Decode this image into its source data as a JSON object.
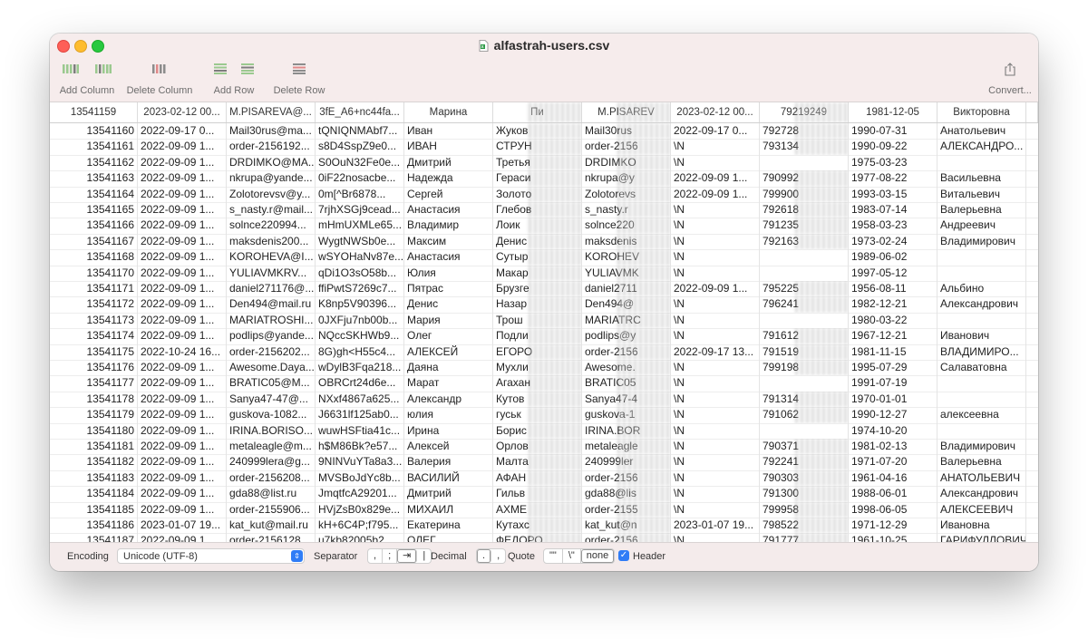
{
  "window": {
    "title": "alfastrah-users.csv"
  },
  "toolbar": {
    "add_column": "Add Column",
    "delete_column": "Delete Column",
    "add_row": "Add Row",
    "delete_row": "Delete Row",
    "convert": "Convert..."
  },
  "header_row": [
    "13541159",
    "2023-02-12 00...",
    "M.PISAREVA@...",
    "3fE_A6+nc44fa...",
    "Марина",
    "Пи",
    "M.PISAREV",
    "2023-02-12 00...",
    "79219249",
    "1981-12-05",
    "Викторовна"
  ],
  "rows": [
    [
      "13541160",
      "2022-09-17 0...",
      "Mail30rus@ma...",
      "tQNIQNMAbf7...",
      "Иван",
      "Жуков",
      "Mail30rus",
      "2022-09-17 0...",
      "792728",
      "1990-07-31",
      "Анатольевич"
    ],
    [
      "13541161",
      "2022-09-09 1...",
      "order-2156192...",
      "s8D4SspZ9e0...",
      "ИВАН",
      "СТРУН",
      "order-2156",
      "\\N",
      "793134",
      "1990-09-22",
      "АЛЕКСАНДРО..."
    ],
    [
      "13541162",
      "2022-09-09 1...",
      "DRDIMKO@MA...",
      "S0OuN32Fe0e...",
      "Дмитрий",
      "Третья",
      "DRDIMKO",
      "\\N",
      "",
      "1975-03-23",
      ""
    ],
    [
      "13541163",
      "2022-09-09 1...",
      "nkrupa@yande...",
      "0iF22nosacbe...",
      "Надежда",
      "Гераси",
      "nkrupa@y",
      "2022-09-09 1...",
      "790992",
      "1977-08-22",
      "Васильевна"
    ],
    [
      "13541164",
      "2022-09-09 1...",
      "Zolotorevsv@y...",
      "0m[^Br6878...",
      "Сергей",
      "Золото",
      "Zolotorevs",
      "2022-09-09 1...",
      "799900",
      "1993-03-15",
      "Витальевич"
    ],
    [
      "13541165",
      "2022-09-09 1...",
      "s_nasty.r@mail...",
      "7rjhXSGj9cead...",
      "Анастасия",
      "Глебов",
      "s_nasty.r",
      "\\N",
      "792618",
      "1983-07-14",
      "Валерьевна"
    ],
    [
      "13541166",
      "2022-09-09 1...",
      "solnce220994...",
      "mHmUXMLe65...",
      "Владимир",
      "Лоик",
      "solnce220",
      "\\N",
      "791235",
      "1958-03-23",
      "Андреевич"
    ],
    [
      "13541167",
      "2022-09-09 1...",
      "maksdenis200...",
      "WygtNWSb0e...",
      "Максим",
      "Денис",
      "maksdenis",
      "\\N",
      "792163",
      "1973-02-24",
      "Владимирович"
    ],
    [
      "13541168",
      "2022-09-09 1...",
      "KOROHEVA@I...",
      "wSYOHaNv87e...",
      "Анастасия",
      "Сутыр",
      "KOROHEV",
      "\\N",
      "",
      "1989-06-02",
      ""
    ],
    [
      "13541170",
      "2022-09-09 1...",
      "YULIAVMKRV...",
      "qDi1O3sO58b...",
      "Юлия",
      "Макар",
      "YULIAVMK",
      "\\N",
      "",
      "1997-05-12",
      ""
    ],
    [
      "13541171",
      "2022-09-09 1...",
      "daniel271176@...",
      "ffiPwtS7269c7...",
      "Пятрас",
      "Брузге",
      "daniel2711",
      "2022-09-09 1...",
      "795225",
      "1956-08-11",
      "Альбино"
    ],
    [
      "13541172",
      "2022-09-09 1...",
      "Den494@mail.ru",
      "K8np5V90396...",
      "Денис",
      "Назар",
      "Den494@",
      "\\N",
      "796241",
      "1982-12-21",
      "Александрович"
    ],
    [
      "13541173",
      "2022-09-09 1...",
      "MARIATROSHI...",
      "0JXFju7nb00b...",
      "Мария",
      "Трош",
      "MARIATRC",
      "\\N",
      "",
      "1980-03-22",
      ""
    ],
    [
      "13541174",
      "2022-09-09 1...",
      "podlips@yande...",
      "NQccSKHWb9...",
      "Олег",
      "Подли",
      "podlips@y",
      "\\N",
      "791612",
      "1967-12-21",
      "Иванович"
    ],
    [
      "13541175",
      "2022-10-24 16...",
      "order-2156202...",
      "8G)gh<H55c4...",
      "АЛЕКСЕЙ",
      "ЕГОРО",
      "order-2156",
      "2022-09-17 13...",
      "791519",
      "1981-11-15",
      "ВЛАДИМИРО..."
    ],
    [
      "13541176",
      "2022-09-09 1...",
      "Awesome.Daya...",
      "wDylB3Fqa218...",
      "Даяна",
      "Мухли",
      "Awesome.",
      "\\N",
      "799198",
      "1995-07-29",
      "Салаватовна"
    ],
    [
      "13541177",
      "2022-09-09 1...",
      "BRATIC05@M...",
      "OBRCrt24d6e...",
      "Марат",
      "Агахан",
      "BRATIC05",
      "\\N",
      "",
      "1991-07-19",
      ""
    ],
    [
      "13541178",
      "2022-09-09 1...",
      "Sanya47-47@...",
      "NXxf4867a625...",
      "Александр",
      "Кутов",
      "Sanya47-4",
      "\\N",
      "791314",
      "1970-01-01",
      ""
    ],
    [
      "13541179",
      "2022-09-09 1...",
      "guskova-1082...",
      "J6631lf125ab0...",
      "юлия",
      "гуськ",
      "guskova-1",
      "\\N",
      "791062",
      "1990-12-27",
      "алексеевна"
    ],
    [
      "13541180",
      "2022-09-09 1...",
      "IRINA.BORISO...",
      "wuwHSFtia41c...",
      "Ирина",
      "Борис",
      "IRINA.BOR",
      "\\N",
      "",
      "1974-10-20",
      ""
    ],
    [
      "13541181",
      "2022-09-09 1...",
      "metaleagle@m...",
      "h$M86Bk?e57...",
      "Алексей",
      "Орлов",
      "metaleagle",
      "\\N",
      "790371",
      "1981-02-13",
      "Владимирович"
    ],
    [
      "13541182",
      "2022-09-09 1...",
      "240999lera@g...",
      "9NINVuYTa8a3...",
      "Валерия",
      "Малта",
      "240999ler",
      "\\N",
      "792241",
      "1971-07-20",
      "Валерьевна"
    ],
    [
      "13541183",
      "2022-09-09 1...",
      "order-2156208...",
      "MVSBoJdYc8b...",
      "ВАСИЛИЙ",
      "АФАН",
      "order-2156",
      "\\N",
      "790303",
      "1961-04-16",
      "АНАТОЛЬЕВИЧ"
    ],
    [
      "13541184",
      "2022-09-09 1...",
      "gda88@list.ru",
      "JmqtfcA29201...",
      "Дмитрий",
      "Гильв",
      "gda88@lis",
      "\\N",
      "791300",
      "1988-06-01",
      "Александрович"
    ],
    [
      "13541185",
      "2022-09-09 1...",
      "order-2155906...",
      "HVjZsB0x829e...",
      "МИХАИЛ",
      "АХМЕ",
      "order-2155",
      "\\N",
      "799958",
      "1998-06-05",
      "АЛЕКСЕЕВИЧ"
    ],
    [
      "13541186",
      "2023-01-07 19...",
      "kat_kut@mail.ru",
      "kH+6C4P;f795...",
      "Екатерина",
      "Кутахс",
      "kat_kut@n",
      "2023-01-07 19...",
      "798522",
      "1971-12-29",
      "Ивановна"
    ],
    [
      "13541187",
      "2022-09-09 1...",
      "order-2156128...",
      "u7kb82005b2...",
      "ОЛЕГ",
      "ФЕДОРО",
      "order-2156",
      "\\N",
      "791777",
      "1961-10-25",
      "ГАРИФУЛЛОВИЧ"
    ]
  ],
  "footer": {
    "encoding_label": "Encoding",
    "encoding_value": "Unicode (UTF-8)",
    "separator_label": "Separator",
    "separator_options": [
      ",",
      ";",
      "⇥",
      "|"
    ],
    "decimal_label": "Decimal",
    "decimal_options": [
      ".",
      ","
    ],
    "quote_label": "Quote",
    "quote_options": [
      "\"\"",
      "\\\"",
      "none"
    ],
    "header_label": "Header",
    "header_checked": true
  }
}
